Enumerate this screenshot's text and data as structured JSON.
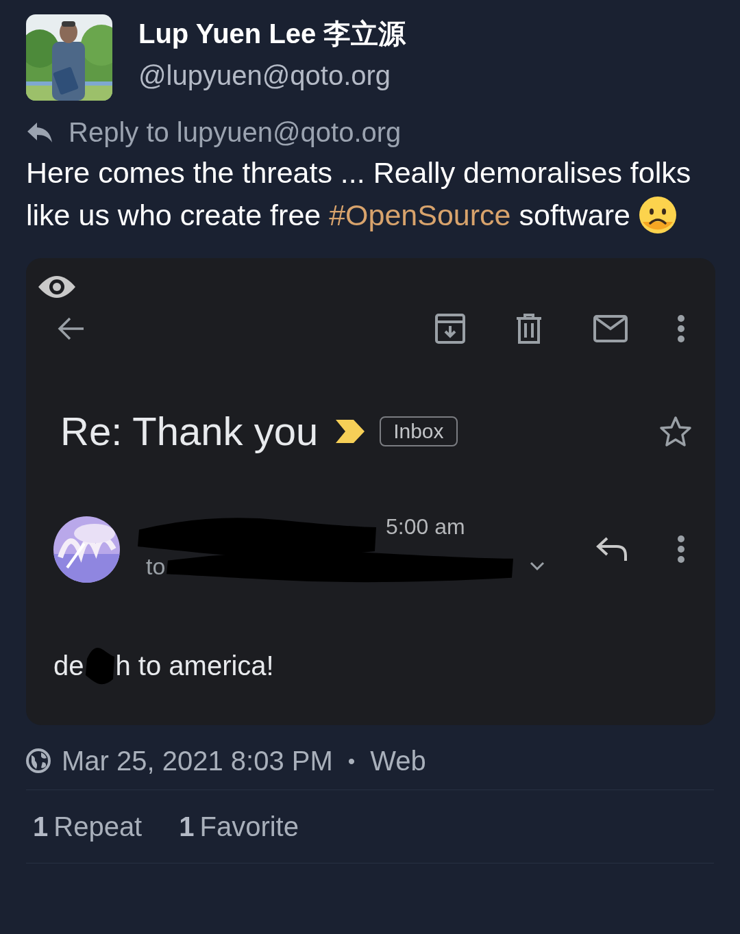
{
  "author": {
    "name": "Lup Yuen Lee 李立源",
    "handle": "@lupyuen@qoto.org"
  },
  "reply_to": "Reply to lupyuen@qoto.org",
  "content": [
    {
      "kind": "text",
      "text": "Here comes the threats ... Really demoralises folks like us who create free "
    },
    {
      "kind": "hashtag",
      "text": "#OpenSource"
    },
    {
      "kind": "text",
      "text": " software "
    },
    {
      "kind": "emoji"
    }
  ],
  "attachment": {
    "subject": "Re: Thank you",
    "important": true,
    "label": "Inbox",
    "starred": false,
    "time": "5:00 am",
    "to_prefix": "to",
    "body_parts": [
      "de",
      "h to america!"
    ]
  },
  "meta": {
    "date": "Mar 25, 2021 8:03 PM",
    "separator": "•",
    "source": "Web"
  },
  "stats": [
    {
      "count": "1",
      "label": "Repeat"
    },
    {
      "count": "1",
      "label": "Favorite"
    }
  ]
}
